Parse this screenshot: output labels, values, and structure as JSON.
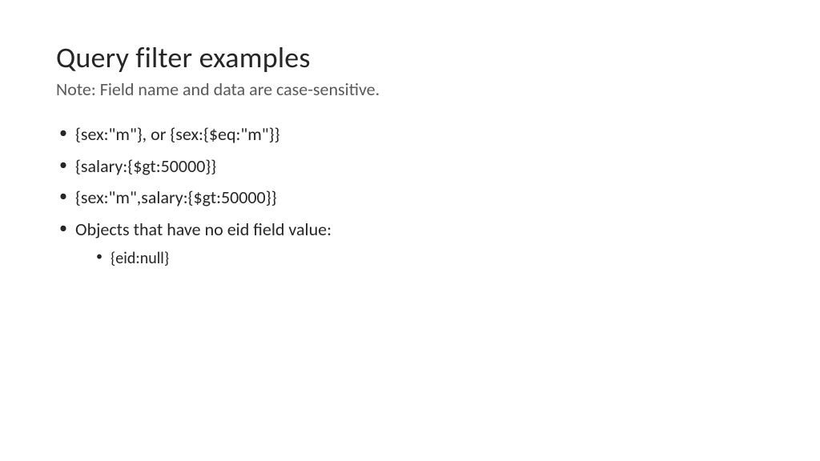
{
  "slide": {
    "title": "Query filter examples",
    "subtitle": "Note: Field name and data are case-sensitive.",
    "bullets": [
      "{sex:\"m\"}, or {sex:{$eq:\"m\"}}",
      "{salary:{$gt:50000}}",
      "{sex:\"m\",salary:{$gt:50000}}",
      "Objects that have no eid field value:"
    ],
    "sub_bullets": [
      "{eid:null}"
    ]
  }
}
